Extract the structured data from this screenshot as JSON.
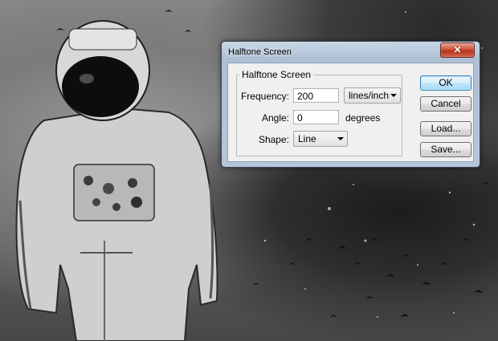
{
  "dialog": {
    "title": "Halftone Screen",
    "close_icon": "close-x-icon",
    "group_title": "Halftone Screen",
    "frequency": {
      "label": "Frequency:",
      "value": "200",
      "unit": "lines/inch"
    },
    "angle": {
      "label": "Angle:",
      "value": "0",
      "unit": "degrees"
    },
    "shape": {
      "label": "Shape:",
      "value": "Line"
    },
    "buttons": {
      "ok": "OK",
      "cancel": "Cancel",
      "load": "Load...",
      "save": "Save..."
    }
  },
  "colors": {
    "titlebar": "#b7c7da",
    "close_button": "#c8432a",
    "dialog_body": "#f0f0f0",
    "default_button": "#bee6fd"
  }
}
